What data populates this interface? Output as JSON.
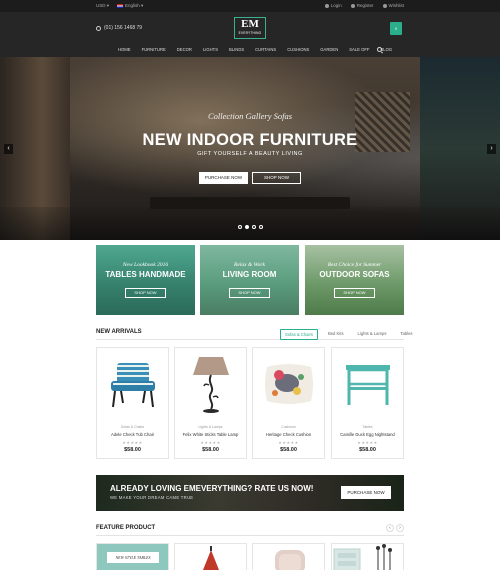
{
  "topbar": {
    "currency": "USD",
    "language": "English",
    "login": "Login",
    "register": "Register",
    "wishlist": "Wishlist"
  },
  "header": {
    "phone": "(01) 156 1468 79",
    "logo_main": "EM",
    "logo_sub": "EVERYTHING",
    "cart_count": "0",
    "nav": [
      "HOME",
      "FURNITURE",
      "DECOR",
      "LIGHTS",
      "BLINDS",
      "CURTAINS",
      "CUSHIONS",
      "GARDEN",
      "SALE OFF",
      "BLOG"
    ]
  },
  "hero": {
    "subtitle": "Collection Gallery Sofas",
    "title": "NEW INDOOR FURNITURE",
    "tagline": "GIFT YOURSELF A BEAUTY LIVING",
    "btn_purchase": "PURCHASE NOW",
    "btn_shop": "SHOP NOW",
    "slides": 4,
    "active_slide": 1
  },
  "banners": [
    {
      "subtitle": "New Lookbook 2016",
      "title": "TABLES HANDMADE",
      "button": "SHOP NOW"
    },
    {
      "subtitle": "Relax & Work",
      "title": "LIVING ROOM",
      "button": "SHOP NOW"
    },
    {
      "subtitle": "Best Choice for Summer",
      "title": "OUTDOOR SOFAS",
      "button": "SHOP NOW"
    }
  ],
  "new_arrivals": {
    "title": "NEW ARRIVALS",
    "tabs": [
      "Sofas & Chairs",
      "Bed Kits",
      "Lights & Lamps",
      "Tables"
    ],
    "active_tab": 0,
    "products": [
      {
        "category": "Sofas & Chairs",
        "name": "Adele Check Tub Chair",
        "stars": "★★★★★",
        "price": "$58.00"
      },
      {
        "category": "Lights & Lamps",
        "name": "Felix White Sticks Table Lamp",
        "stars": "★★★★★",
        "price": "$58.00"
      },
      {
        "category": "Cushions",
        "name": "Heritage Check Cushion",
        "stars": "★★★★★",
        "price": "$58.00"
      },
      {
        "category": "Tables",
        "name": "Camille Duck Egg Nightstand",
        "stars": "★★★★★",
        "price": "$58.00"
      }
    ]
  },
  "rate_banner": {
    "title": "ALREADY LOVING EMEVERYTHING? RATE US NOW!",
    "subtitle": "WE MAKE YOUR DREAM CAME TRUE",
    "button": "PURCHASE NOW"
  },
  "feature": {
    "title": "FEATURE PRODUCT",
    "first_card_label": "NEW STYLE TABLES",
    "prev": "‹",
    "next": "›"
  },
  "colors": {
    "accent": "#2bae8b",
    "dark_header": "#262626",
    "topbar": "#1c1c1c"
  }
}
